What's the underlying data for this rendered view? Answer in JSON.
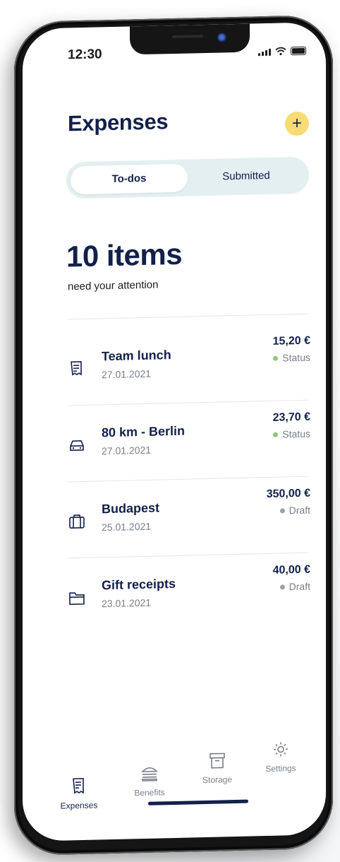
{
  "status_bar": {
    "time": "12:30"
  },
  "header": {
    "title": "Expenses",
    "add_icon": "plus-icon"
  },
  "segment": {
    "active": "To-dos",
    "other": "Submitted"
  },
  "summary": {
    "count": "10 items",
    "subtitle": "need your attention"
  },
  "items": [
    {
      "name": "Team lunch",
      "date": "27.01.2021",
      "amount": "15,20 €",
      "status": "Status",
      "status_color": "#8cc97a",
      "icon": "receipt-icon"
    },
    {
      "name": "80 km - Berlin",
      "date": "27.01.2021",
      "amount": "23,70 €",
      "status": "Status",
      "status_color": "#8cc97a",
      "icon": "car-icon"
    },
    {
      "name": "Budapest",
      "date": "25.01.2021",
      "amount": "350,00 €",
      "status": "Draft",
      "status_color": "#9aa0a8",
      "icon": "suitcase-icon"
    },
    {
      "name": "Gift receipts",
      "date": "23.01.2021",
      "amount": "40,00 €",
      "status": "Draft",
      "status_color": "#9aa0a8",
      "icon": "folder-icon"
    }
  ],
  "tabs": [
    {
      "label": "Expenses",
      "icon": "receipt-icon"
    },
    {
      "label": "Benefits",
      "icon": "burger-icon"
    },
    {
      "label": "Storage",
      "icon": "archive-box-icon"
    },
    {
      "label": "Settings",
      "icon": "gear-icon"
    }
  ],
  "colors": {
    "accent": "#f7dc72",
    "primary": "#12204a",
    "segment_bg": "#e3eff1"
  }
}
